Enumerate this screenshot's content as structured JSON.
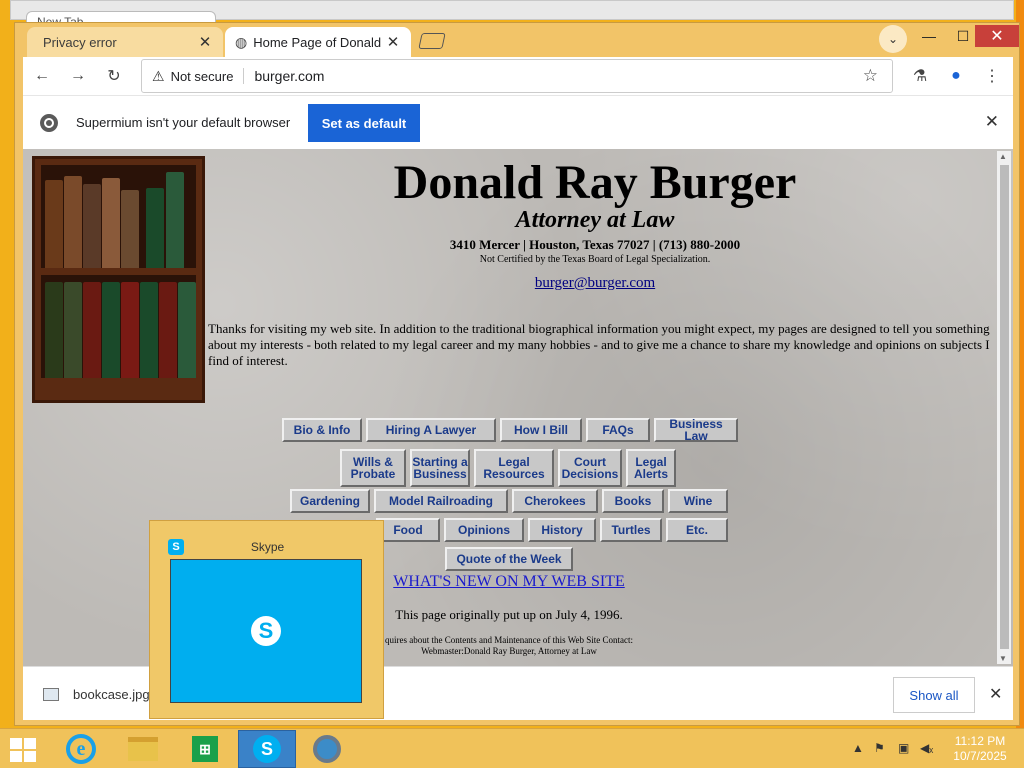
{
  "background_window": {
    "tab_title": "New Tab"
  },
  "browser": {
    "tabs": [
      {
        "title": "Privacy error",
        "close": "✕"
      },
      {
        "title": "Home Page of Donald R",
        "close": "✕"
      }
    ],
    "window_controls": {
      "minimize": "—",
      "maximize": "☐",
      "close": "✕"
    },
    "address": {
      "security": "Not secure",
      "url": "burger.com"
    },
    "infobar": {
      "message": "Supermium isn't your default browser",
      "button": "Set as default",
      "close": "✕"
    }
  },
  "page": {
    "name": "Donald Ray Burger",
    "subtitle": "Attorney at Law",
    "address": "3410 Mercer | Houston, Texas 77027 | (713) 880-2000",
    "certification": "Not Certified by the Texas Board of Legal Specialization.",
    "email": "burger@burger.com",
    "intro": "Thanks for visiting my web site. In addition to the traditional biographical information you might expect, my pages are designed to tell you something about my interests - both related to my legal career and my many hobbies - and to give me a chance to share my knowledge and opinions on subjects I find of interest.",
    "nav_rows": [
      [
        "Bio & Info",
        "Hiring A Lawyer",
        "How I Bill",
        "FAQs",
        "Business Law"
      ],
      [
        "Wills & Probate",
        "Starting a Business",
        "Legal Resources",
        "Court Decisions",
        "Legal Alerts"
      ],
      [
        "Gardening",
        "Model Railroading",
        "Cherokees",
        "Books",
        "Wine"
      ],
      [
        "Food",
        "Opinions",
        "History",
        "Turtles",
        "Etc."
      ],
      [
        "Quote of the Week"
      ]
    ],
    "whats_new": "WHAT'S NEW ON MY WEB SITE",
    "put_up": "This page originally put up on July 4, 1996.",
    "contact_line1": "quires about the Contents and Maintenance of this Web Site Contact:",
    "contact_line2": "Webmaster:Donald Ray Burger, Attorney at Law"
  },
  "downloads": {
    "file": "bookcase.jpg",
    "show_all": "Show all",
    "close": "✕"
  },
  "skype_preview": {
    "title": "Skype"
  },
  "taskbar": {
    "time": "11:12 PM",
    "date": "10/7/2025"
  },
  "colors": {
    "accent_button": "#1a64d6",
    "link": "#1a1acc",
    "nav_text": "#1a3a8a",
    "desktop": "#f2b01a"
  }
}
